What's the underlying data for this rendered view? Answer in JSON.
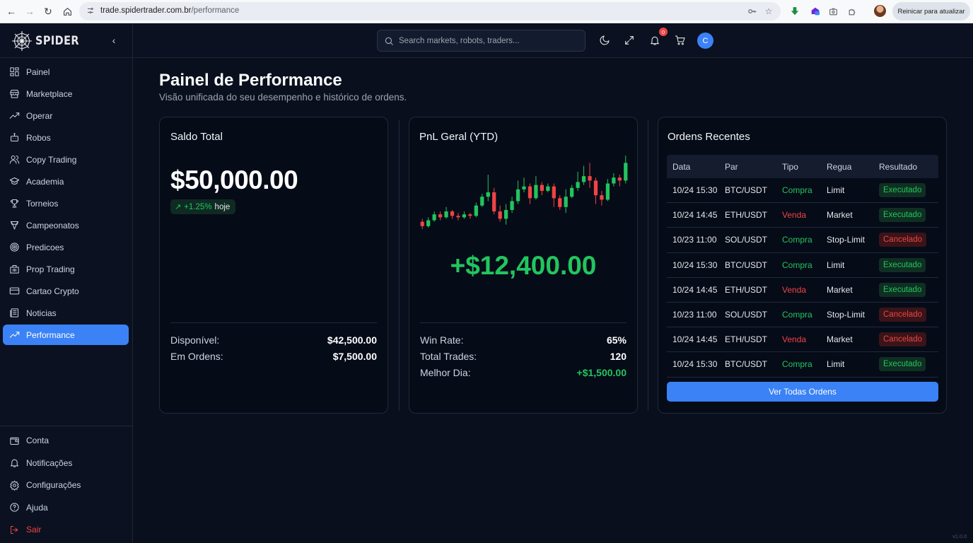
{
  "browser": {
    "url_host": "trade.spidertrader.com.br",
    "url_path": "/performance",
    "update_button": "Reinicar para atualizar"
  },
  "brand": {
    "name": "SPIDER"
  },
  "sidebar": {
    "items": [
      {
        "label": "Painel",
        "icon": "grid-icon"
      },
      {
        "label": "Marketplace",
        "icon": "store-icon"
      },
      {
        "label": "Operar",
        "icon": "trending-up-icon"
      },
      {
        "label": "Robos",
        "icon": "bot-icon"
      },
      {
        "label": "Copy Trading",
        "icon": "users-icon"
      },
      {
        "label": "Academia",
        "icon": "graduation-cap-icon"
      },
      {
        "label": "Torneios",
        "icon": "trophy-icon"
      },
      {
        "label": "Campeonatos",
        "icon": "award-icon"
      },
      {
        "label": "Predicoes",
        "icon": "target-icon"
      },
      {
        "label": "Prop Trading",
        "icon": "building-icon"
      },
      {
        "label": "Cartao Crypto",
        "icon": "credit-card-icon"
      },
      {
        "label": "Noticias",
        "icon": "newspaper-icon"
      },
      {
        "label": "Performance",
        "icon": "trending-up-icon",
        "active": true
      }
    ],
    "bottom_items": [
      {
        "label": "Conta",
        "icon": "wallet-icon"
      },
      {
        "label": "Notificações",
        "icon": "bell-icon"
      },
      {
        "label": "Configurações",
        "icon": "gear-icon"
      },
      {
        "label": "Ajuda",
        "icon": "help-circle-icon"
      },
      {
        "label": "Sair",
        "icon": "logout-icon"
      }
    ]
  },
  "topbar": {
    "search_placeholder": "Search markets, robots, traders...",
    "notification_count": "0",
    "avatar_initial": "C"
  },
  "page": {
    "title": "Painel de Performance",
    "subtitle": "Visão unificada do seu desempenho e histórico de ordens."
  },
  "balance_card": {
    "title": "Saldo Total",
    "amount": "$50,000.00",
    "change_pct": "+1.25%",
    "change_label": "hoje",
    "available_label": "Disponível:",
    "available_value": "$42,500.00",
    "in_orders_label": "Em Ordens:",
    "in_orders_value": "$7,500.00"
  },
  "pnl_card": {
    "title": "PnL Geral (YTD)",
    "amount": "+$12,400.00",
    "win_rate_label": "Win Rate:",
    "win_rate_value": "65%",
    "total_trades_label": "Total Trades:",
    "total_trades_value": "120",
    "best_day_label": "Melhor Dia:",
    "best_day_value": "+$1,500.00"
  },
  "chart_data": {
    "type": "candlestick",
    "colors": {
      "up": "#22c55e",
      "down": "#ef4444"
    },
    "candles": [
      {
        "o": 8,
        "c": 5,
        "h": 10,
        "l": 3
      },
      {
        "o": 5,
        "c": 9,
        "h": 11,
        "l": 4
      },
      {
        "o": 9,
        "c": 13,
        "h": 15,
        "l": 8
      },
      {
        "o": 13,
        "c": 11,
        "h": 15,
        "l": 9
      },
      {
        "o": 11,
        "c": 15,
        "h": 18,
        "l": 10
      },
      {
        "o": 15,
        "c": 12,
        "h": 16,
        "l": 10
      },
      {
        "o": 12,
        "c": 11,
        "h": 14,
        "l": 9
      },
      {
        "o": 11,
        "c": 13,
        "h": 15,
        "l": 10
      },
      {
        "o": 13,
        "c": 12,
        "h": 14,
        "l": 10
      },
      {
        "o": 12,
        "c": 19,
        "h": 21,
        "l": 11
      },
      {
        "o": 19,
        "c": 25,
        "h": 27,
        "l": 18
      },
      {
        "o": 25,
        "c": 28,
        "h": 40,
        "l": 22
      },
      {
        "o": 28,
        "c": 15,
        "h": 31,
        "l": 13
      },
      {
        "o": 15,
        "c": 10,
        "h": 19,
        "l": 8
      },
      {
        "o": 10,
        "c": 16,
        "h": 20,
        "l": 6
      },
      {
        "o": 16,
        "c": 22,
        "h": 25,
        "l": 14
      },
      {
        "o": 22,
        "c": 30,
        "h": 36,
        "l": 20
      },
      {
        "o": 30,
        "c": 32,
        "h": 38,
        "l": 28
      },
      {
        "o": 32,
        "c": 24,
        "h": 34,
        "l": 20
      },
      {
        "o": 24,
        "c": 33,
        "h": 39,
        "l": 23
      },
      {
        "o": 33,
        "c": 29,
        "h": 35,
        "l": 26
      },
      {
        "o": 29,
        "c": 32,
        "h": 34,
        "l": 28
      },
      {
        "o": 32,
        "c": 24,
        "h": 34,
        "l": 18
      },
      {
        "o": 24,
        "c": 18,
        "h": 26,
        "l": 16
      },
      {
        "o": 18,
        "c": 25,
        "h": 30,
        "l": 14
      },
      {
        "o": 25,
        "c": 31,
        "h": 33,
        "l": 24
      },
      {
        "o": 31,
        "c": 35,
        "h": 42,
        "l": 29
      },
      {
        "o": 35,
        "c": 39,
        "h": 46,
        "l": 33
      },
      {
        "o": 39,
        "c": 36,
        "h": 48,
        "l": 31
      },
      {
        "o": 36,
        "c": 26,
        "h": 38,
        "l": 20
      },
      {
        "o": 26,
        "c": 23,
        "h": 29,
        "l": 19
      },
      {
        "o": 23,
        "c": 34,
        "h": 37,
        "l": 22
      },
      {
        "o": 34,
        "c": 38,
        "h": 41,
        "l": 32
      },
      {
        "o": 38,
        "c": 36,
        "h": 40,
        "l": 32
      },
      {
        "o": 36,
        "c": 48,
        "h": 53,
        "l": 34
      }
    ]
  },
  "orders_card": {
    "title": "Ordens Recentes",
    "columns": [
      "Data",
      "Par",
      "Tipo",
      "Regua",
      "Resultado"
    ],
    "rows": [
      {
        "date": "10/24 15:30",
        "pair": "BTC/USDT",
        "type": "Compra",
        "rule": "Limit",
        "result": "Executado"
      },
      {
        "date": "10/24 14:45",
        "pair": "ETH/USDT",
        "type": "Venda",
        "rule": "Market",
        "result": "Executado"
      },
      {
        "date": "10/23 11:00",
        "pair": "SOL/USDT",
        "type": "Compra",
        "rule": "Stop-Limit",
        "result": "Cancelado"
      },
      {
        "date": "10/24 15:30",
        "pair": "BTC/USDT",
        "type": "Compra",
        "rule": "Limit",
        "result": "Executado"
      },
      {
        "date": "10/24 14:45",
        "pair": "ETH/USDT",
        "type": "Venda",
        "rule": "Market",
        "result": "Executado"
      },
      {
        "date": "10/23 11:00",
        "pair": "SOL/USDT",
        "type": "Compra",
        "rule": "Stop-Limit",
        "result": "Cancelado"
      },
      {
        "date": "10/24 14:45",
        "pair": "ETH/USDT",
        "type": "Venda",
        "rule": "Market",
        "result": "Cancelado"
      },
      {
        "date": "10/24 15:30",
        "pair": "BTC/USDT",
        "type": "Compra",
        "rule": "Limit",
        "result": "Executado"
      }
    ],
    "button": "Ver Todas Ordens"
  },
  "footer": {
    "version": "v1.0.0"
  }
}
